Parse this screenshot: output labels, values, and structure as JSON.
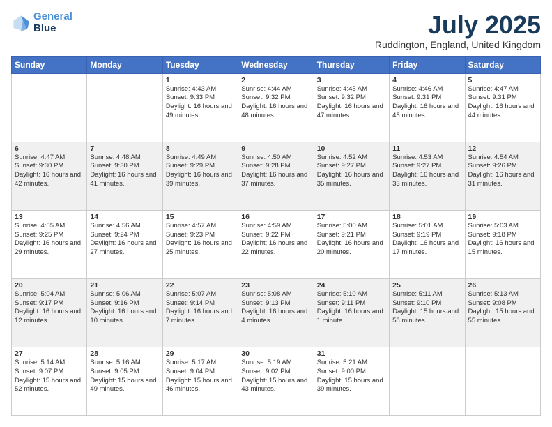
{
  "logo": {
    "line1": "General",
    "line2": "Blue"
  },
  "title": "July 2025",
  "location": "Ruddington, England, United Kingdom",
  "days_header": [
    "Sunday",
    "Monday",
    "Tuesday",
    "Wednesday",
    "Thursday",
    "Friday",
    "Saturday"
  ],
  "weeks": [
    [
      {
        "day": "",
        "sunrise": "",
        "sunset": "",
        "daylight": ""
      },
      {
        "day": "",
        "sunrise": "",
        "sunset": "",
        "daylight": ""
      },
      {
        "day": "1",
        "sunrise": "Sunrise: 4:43 AM",
        "sunset": "Sunset: 9:33 PM",
        "daylight": "Daylight: 16 hours and 49 minutes."
      },
      {
        "day": "2",
        "sunrise": "Sunrise: 4:44 AM",
        "sunset": "Sunset: 9:32 PM",
        "daylight": "Daylight: 16 hours and 48 minutes."
      },
      {
        "day": "3",
        "sunrise": "Sunrise: 4:45 AM",
        "sunset": "Sunset: 9:32 PM",
        "daylight": "Daylight: 16 hours and 47 minutes."
      },
      {
        "day": "4",
        "sunrise": "Sunrise: 4:46 AM",
        "sunset": "Sunset: 9:31 PM",
        "daylight": "Daylight: 16 hours and 45 minutes."
      },
      {
        "day": "5",
        "sunrise": "Sunrise: 4:47 AM",
        "sunset": "Sunset: 9:31 PM",
        "daylight": "Daylight: 16 hours and 44 minutes."
      }
    ],
    [
      {
        "day": "6",
        "sunrise": "Sunrise: 4:47 AM",
        "sunset": "Sunset: 9:30 PM",
        "daylight": "Daylight: 16 hours and 42 minutes."
      },
      {
        "day": "7",
        "sunrise": "Sunrise: 4:48 AM",
        "sunset": "Sunset: 9:30 PM",
        "daylight": "Daylight: 16 hours and 41 minutes."
      },
      {
        "day": "8",
        "sunrise": "Sunrise: 4:49 AM",
        "sunset": "Sunset: 9:29 PM",
        "daylight": "Daylight: 16 hours and 39 minutes."
      },
      {
        "day": "9",
        "sunrise": "Sunrise: 4:50 AM",
        "sunset": "Sunset: 9:28 PM",
        "daylight": "Daylight: 16 hours and 37 minutes."
      },
      {
        "day": "10",
        "sunrise": "Sunrise: 4:52 AM",
        "sunset": "Sunset: 9:27 PM",
        "daylight": "Daylight: 16 hours and 35 minutes."
      },
      {
        "day": "11",
        "sunrise": "Sunrise: 4:53 AM",
        "sunset": "Sunset: 9:27 PM",
        "daylight": "Daylight: 16 hours and 33 minutes."
      },
      {
        "day": "12",
        "sunrise": "Sunrise: 4:54 AM",
        "sunset": "Sunset: 9:26 PM",
        "daylight": "Daylight: 16 hours and 31 minutes."
      }
    ],
    [
      {
        "day": "13",
        "sunrise": "Sunrise: 4:55 AM",
        "sunset": "Sunset: 9:25 PM",
        "daylight": "Daylight: 16 hours and 29 minutes."
      },
      {
        "day": "14",
        "sunrise": "Sunrise: 4:56 AM",
        "sunset": "Sunset: 9:24 PM",
        "daylight": "Daylight: 16 hours and 27 minutes."
      },
      {
        "day": "15",
        "sunrise": "Sunrise: 4:57 AM",
        "sunset": "Sunset: 9:23 PM",
        "daylight": "Daylight: 16 hours and 25 minutes."
      },
      {
        "day": "16",
        "sunrise": "Sunrise: 4:59 AM",
        "sunset": "Sunset: 9:22 PM",
        "daylight": "Daylight: 16 hours and 22 minutes."
      },
      {
        "day": "17",
        "sunrise": "Sunrise: 5:00 AM",
        "sunset": "Sunset: 9:21 PM",
        "daylight": "Daylight: 16 hours and 20 minutes."
      },
      {
        "day": "18",
        "sunrise": "Sunrise: 5:01 AM",
        "sunset": "Sunset: 9:19 PM",
        "daylight": "Daylight: 16 hours and 17 minutes."
      },
      {
        "day": "19",
        "sunrise": "Sunrise: 5:03 AM",
        "sunset": "Sunset: 9:18 PM",
        "daylight": "Daylight: 16 hours and 15 minutes."
      }
    ],
    [
      {
        "day": "20",
        "sunrise": "Sunrise: 5:04 AM",
        "sunset": "Sunset: 9:17 PM",
        "daylight": "Daylight: 16 hours and 12 minutes."
      },
      {
        "day": "21",
        "sunrise": "Sunrise: 5:06 AM",
        "sunset": "Sunset: 9:16 PM",
        "daylight": "Daylight: 16 hours and 10 minutes."
      },
      {
        "day": "22",
        "sunrise": "Sunrise: 5:07 AM",
        "sunset": "Sunset: 9:14 PM",
        "daylight": "Daylight: 16 hours and 7 minutes."
      },
      {
        "day": "23",
        "sunrise": "Sunrise: 5:08 AM",
        "sunset": "Sunset: 9:13 PM",
        "daylight": "Daylight: 16 hours and 4 minutes."
      },
      {
        "day": "24",
        "sunrise": "Sunrise: 5:10 AM",
        "sunset": "Sunset: 9:11 PM",
        "daylight": "Daylight: 16 hours and 1 minute."
      },
      {
        "day": "25",
        "sunrise": "Sunrise: 5:11 AM",
        "sunset": "Sunset: 9:10 PM",
        "daylight": "Daylight: 15 hours and 58 minutes."
      },
      {
        "day": "26",
        "sunrise": "Sunrise: 5:13 AM",
        "sunset": "Sunset: 9:08 PM",
        "daylight": "Daylight: 15 hours and 55 minutes."
      }
    ],
    [
      {
        "day": "27",
        "sunrise": "Sunrise: 5:14 AM",
        "sunset": "Sunset: 9:07 PM",
        "daylight": "Daylight: 15 hours and 52 minutes."
      },
      {
        "day": "28",
        "sunrise": "Sunrise: 5:16 AM",
        "sunset": "Sunset: 9:05 PM",
        "daylight": "Daylight: 15 hours and 49 minutes."
      },
      {
        "day": "29",
        "sunrise": "Sunrise: 5:17 AM",
        "sunset": "Sunset: 9:04 PM",
        "daylight": "Daylight: 15 hours and 46 minutes."
      },
      {
        "day": "30",
        "sunrise": "Sunrise: 5:19 AM",
        "sunset": "Sunset: 9:02 PM",
        "daylight": "Daylight: 15 hours and 43 minutes."
      },
      {
        "day": "31",
        "sunrise": "Sunrise: 5:21 AM",
        "sunset": "Sunset: 9:00 PM",
        "daylight": "Daylight: 15 hours and 39 minutes."
      },
      {
        "day": "",
        "sunrise": "",
        "sunset": "",
        "daylight": ""
      },
      {
        "day": "",
        "sunrise": "",
        "sunset": "",
        "daylight": ""
      }
    ]
  ]
}
